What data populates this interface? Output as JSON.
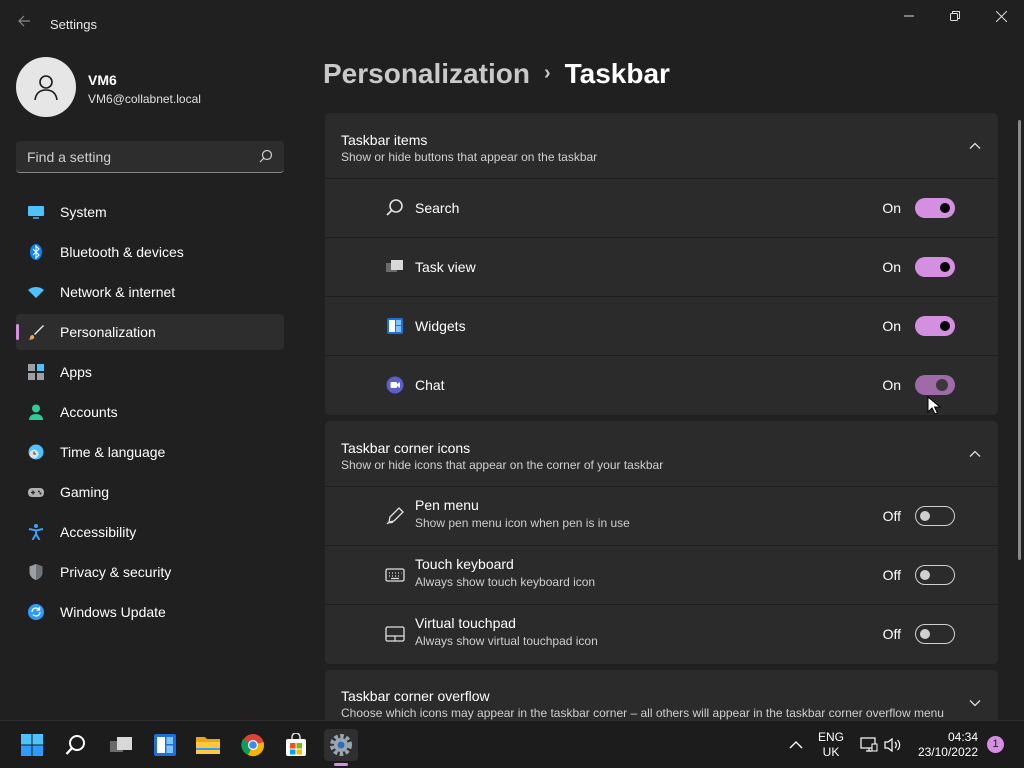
{
  "window": {
    "title": "Settings",
    "back_icon": "back-arrow-icon",
    "controls": [
      "minimize-icon",
      "restore-icon",
      "close-icon"
    ]
  },
  "profile": {
    "name": "VM6",
    "email": "VM6@collabnet.local"
  },
  "search": {
    "placeholder": "Find a setting"
  },
  "nav": {
    "items": [
      {
        "label": "System",
        "icon": "system-monitor-icon",
        "color": "#4cc2ff"
      },
      {
        "label": "Bluetooth & devices",
        "icon": "bluetooth-icon",
        "color": "#0a84ff"
      },
      {
        "label": "Network & internet",
        "icon": "wifi-icon",
        "color": "#4cc2ff"
      },
      {
        "label": "Personalization",
        "icon": "paintbrush-icon",
        "color": "#f0a060",
        "active": true
      },
      {
        "label": "Apps",
        "icon": "apps-icon",
        "color": "#9aa0a6"
      },
      {
        "label": "Accounts",
        "icon": "person-icon",
        "color": "#2ecc9a"
      },
      {
        "label": "Time & language",
        "icon": "globe-clock-icon",
        "color": "#4cc2ff"
      },
      {
        "label": "Gaming",
        "icon": "game-controller-icon",
        "color": "#b0b0b0"
      },
      {
        "label": "Accessibility",
        "icon": "accessibility-icon",
        "color": "#3aa0ff"
      },
      {
        "label": "Privacy & security",
        "icon": "shield-icon",
        "color": "#9aa0a6"
      },
      {
        "label": "Windows Update",
        "icon": "update-icon",
        "color": "#2f9bff"
      }
    ]
  },
  "breadcrumb": {
    "parent": "Personalization",
    "separator": "›",
    "current": "Taskbar"
  },
  "sections": {
    "taskbar_items": {
      "title": "Taskbar items",
      "subtitle": "Show or hide buttons that appear on the taskbar",
      "expanded": true,
      "rows": [
        {
          "label": "Search",
          "state": "On",
          "icon": "search-icon"
        },
        {
          "label": "Task view",
          "state": "On",
          "icon": "task-view-icon"
        },
        {
          "label": "Widgets",
          "state": "On",
          "icon": "widgets-icon"
        },
        {
          "label": "Chat",
          "state": "On",
          "icon": "chat-icon"
        }
      ]
    },
    "corner_icons": {
      "title": "Taskbar corner icons",
      "subtitle": "Show or hide icons that appear on the corner of your taskbar",
      "expanded": true,
      "rows": [
        {
          "label": "Pen menu",
          "desc": "Show pen menu icon when pen is in use",
          "state": "Off",
          "icon": "pen-icon"
        },
        {
          "label": "Touch keyboard",
          "desc": "Always show touch keyboard icon",
          "state": "Off",
          "icon": "keyboard-icon"
        },
        {
          "label": "Virtual touchpad",
          "desc": "Always show virtual touchpad icon",
          "state": "Off",
          "icon": "touchpad-icon"
        }
      ]
    },
    "corner_overflow": {
      "title": "Taskbar corner overflow",
      "subtitle": "Choose which icons may appear in the taskbar corner – all others will appear in the taskbar corner overflow menu",
      "expanded": false
    }
  },
  "accent_color": "#d58fe1",
  "taskbar": {
    "apps": [
      "start-icon",
      "search-icon",
      "task-view-icon",
      "widgets-icon",
      "file-explorer-icon",
      "chrome-icon",
      "store-icon",
      "settings-icon"
    ],
    "language_line1": "ENG",
    "language_line2": "UK",
    "time": "04:34",
    "date": "23/10/2022",
    "notification_count": "1"
  }
}
